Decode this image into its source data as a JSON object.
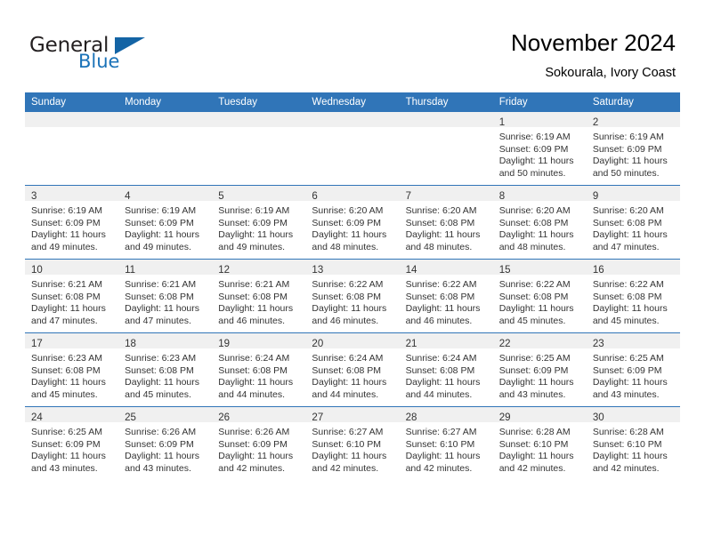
{
  "brand": {
    "name_part1": "General",
    "name_part2": "Blue",
    "flag_icon": "triangle-flag-icon",
    "accent_color": "#1464a5"
  },
  "header": {
    "title": "November 2024",
    "subtitle": "Sokourala, Ivory Coast"
  },
  "calendar": {
    "header_bg": "#3075b8",
    "daynum_bg": "#f0f0f0",
    "weekday_headers": [
      "Sunday",
      "Monday",
      "Tuesday",
      "Wednesday",
      "Thursday",
      "Friday",
      "Saturday"
    ],
    "weeks": [
      [
        {
          "day": "",
          "empty": true,
          "sunrise": "",
          "sunset": "",
          "daylight_line1": "",
          "daylight_line2": ""
        },
        {
          "day": "",
          "empty": true,
          "sunrise": "",
          "sunset": "",
          "daylight_line1": "",
          "daylight_line2": ""
        },
        {
          "day": "",
          "empty": true,
          "sunrise": "",
          "sunset": "",
          "daylight_line1": "",
          "daylight_line2": ""
        },
        {
          "day": "",
          "empty": true,
          "sunrise": "",
          "sunset": "",
          "daylight_line1": "",
          "daylight_line2": ""
        },
        {
          "day": "",
          "empty": true,
          "sunrise": "",
          "sunset": "",
          "daylight_line1": "",
          "daylight_line2": ""
        },
        {
          "day": "1",
          "empty": false,
          "sunrise": "Sunrise: 6:19 AM",
          "sunset": "Sunset: 6:09 PM",
          "daylight_line1": "Daylight: 11 hours",
          "daylight_line2": "and 50 minutes."
        },
        {
          "day": "2",
          "empty": false,
          "sunrise": "Sunrise: 6:19 AM",
          "sunset": "Sunset: 6:09 PM",
          "daylight_line1": "Daylight: 11 hours",
          "daylight_line2": "and 50 minutes."
        }
      ],
      [
        {
          "day": "3",
          "empty": false,
          "sunrise": "Sunrise: 6:19 AM",
          "sunset": "Sunset: 6:09 PM",
          "daylight_line1": "Daylight: 11 hours",
          "daylight_line2": "and 49 minutes."
        },
        {
          "day": "4",
          "empty": false,
          "sunrise": "Sunrise: 6:19 AM",
          "sunset": "Sunset: 6:09 PM",
          "daylight_line1": "Daylight: 11 hours",
          "daylight_line2": "and 49 minutes."
        },
        {
          "day": "5",
          "empty": false,
          "sunrise": "Sunrise: 6:19 AM",
          "sunset": "Sunset: 6:09 PM",
          "daylight_line1": "Daylight: 11 hours",
          "daylight_line2": "and 49 minutes."
        },
        {
          "day": "6",
          "empty": false,
          "sunrise": "Sunrise: 6:20 AM",
          "sunset": "Sunset: 6:09 PM",
          "daylight_line1": "Daylight: 11 hours",
          "daylight_line2": "and 48 minutes."
        },
        {
          "day": "7",
          "empty": false,
          "sunrise": "Sunrise: 6:20 AM",
          "sunset": "Sunset: 6:08 PM",
          "daylight_line1": "Daylight: 11 hours",
          "daylight_line2": "and 48 minutes."
        },
        {
          "day": "8",
          "empty": false,
          "sunrise": "Sunrise: 6:20 AM",
          "sunset": "Sunset: 6:08 PM",
          "daylight_line1": "Daylight: 11 hours",
          "daylight_line2": "and 48 minutes."
        },
        {
          "day": "9",
          "empty": false,
          "sunrise": "Sunrise: 6:20 AM",
          "sunset": "Sunset: 6:08 PM",
          "daylight_line1": "Daylight: 11 hours",
          "daylight_line2": "and 47 minutes."
        }
      ],
      [
        {
          "day": "10",
          "empty": false,
          "sunrise": "Sunrise: 6:21 AM",
          "sunset": "Sunset: 6:08 PM",
          "daylight_line1": "Daylight: 11 hours",
          "daylight_line2": "and 47 minutes."
        },
        {
          "day": "11",
          "empty": false,
          "sunrise": "Sunrise: 6:21 AM",
          "sunset": "Sunset: 6:08 PM",
          "daylight_line1": "Daylight: 11 hours",
          "daylight_line2": "and 47 minutes."
        },
        {
          "day": "12",
          "empty": false,
          "sunrise": "Sunrise: 6:21 AM",
          "sunset": "Sunset: 6:08 PM",
          "daylight_line1": "Daylight: 11 hours",
          "daylight_line2": "and 46 minutes."
        },
        {
          "day": "13",
          "empty": false,
          "sunrise": "Sunrise: 6:22 AM",
          "sunset": "Sunset: 6:08 PM",
          "daylight_line1": "Daylight: 11 hours",
          "daylight_line2": "and 46 minutes."
        },
        {
          "day": "14",
          "empty": false,
          "sunrise": "Sunrise: 6:22 AM",
          "sunset": "Sunset: 6:08 PM",
          "daylight_line1": "Daylight: 11 hours",
          "daylight_line2": "and 46 minutes."
        },
        {
          "day": "15",
          "empty": false,
          "sunrise": "Sunrise: 6:22 AM",
          "sunset": "Sunset: 6:08 PM",
          "daylight_line1": "Daylight: 11 hours",
          "daylight_line2": "and 45 minutes."
        },
        {
          "day": "16",
          "empty": false,
          "sunrise": "Sunrise: 6:22 AM",
          "sunset": "Sunset: 6:08 PM",
          "daylight_line1": "Daylight: 11 hours",
          "daylight_line2": "and 45 minutes."
        }
      ],
      [
        {
          "day": "17",
          "empty": false,
          "sunrise": "Sunrise: 6:23 AM",
          "sunset": "Sunset: 6:08 PM",
          "daylight_line1": "Daylight: 11 hours",
          "daylight_line2": "and 45 minutes."
        },
        {
          "day": "18",
          "empty": false,
          "sunrise": "Sunrise: 6:23 AM",
          "sunset": "Sunset: 6:08 PM",
          "daylight_line1": "Daylight: 11 hours",
          "daylight_line2": "and 45 minutes."
        },
        {
          "day": "19",
          "empty": false,
          "sunrise": "Sunrise: 6:24 AM",
          "sunset": "Sunset: 6:08 PM",
          "daylight_line1": "Daylight: 11 hours",
          "daylight_line2": "and 44 minutes."
        },
        {
          "day": "20",
          "empty": false,
          "sunrise": "Sunrise: 6:24 AM",
          "sunset": "Sunset: 6:08 PM",
          "daylight_line1": "Daylight: 11 hours",
          "daylight_line2": "and 44 minutes."
        },
        {
          "day": "21",
          "empty": false,
          "sunrise": "Sunrise: 6:24 AM",
          "sunset": "Sunset: 6:08 PM",
          "daylight_line1": "Daylight: 11 hours",
          "daylight_line2": "and 44 minutes."
        },
        {
          "day": "22",
          "empty": false,
          "sunrise": "Sunrise: 6:25 AM",
          "sunset": "Sunset: 6:09 PM",
          "daylight_line1": "Daylight: 11 hours",
          "daylight_line2": "and 43 minutes."
        },
        {
          "day": "23",
          "empty": false,
          "sunrise": "Sunrise: 6:25 AM",
          "sunset": "Sunset: 6:09 PM",
          "daylight_line1": "Daylight: 11 hours",
          "daylight_line2": "and 43 minutes."
        }
      ],
      [
        {
          "day": "24",
          "empty": false,
          "sunrise": "Sunrise: 6:25 AM",
          "sunset": "Sunset: 6:09 PM",
          "daylight_line1": "Daylight: 11 hours",
          "daylight_line2": "and 43 minutes."
        },
        {
          "day": "25",
          "empty": false,
          "sunrise": "Sunrise: 6:26 AM",
          "sunset": "Sunset: 6:09 PM",
          "daylight_line1": "Daylight: 11 hours",
          "daylight_line2": "and 43 minutes."
        },
        {
          "day": "26",
          "empty": false,
          "sunrise": "Sunrise: 6:26 AM",
          "sunset": "Sunset: 6:09 PM",
          "daylight_line1": "Daylight: 11 hours",
          "daylight_line2": "and 42 minutes."
        },
        {
          "day": "27",
          "empty": false,
          "sunrise": "Sunrise: 6:27 AM",
          "sunset": "Sunset: 6:10 PM",
          "daylight_line1": "Daylight: 11 hours",
          "daylight_line2": "and 42 minutes."
        },
        {
          "day": "28",
          "empty": false,
          "sunrise": "Sunrise: 6:27 AM",
          "sunset": "Sunset: 6:10 PM",
          "daylight_line1": "Daylight: 11 hours",
          "daylight_line2": "and 42 minutes."
        },
        {
          "day": "29",
          "empty": false,
          "sunrise": "Sunrise: 6:28 AM",
          "sunset": "Sunset: 6:10 PM",
          "daylight_line1": "Daylight: 11 hours",
          "daylight_line2": "and 42 minutes."
        },
        {
          "day": "30",
          "empty": false,
          "sunrise": "Sunrise: 6:28 AM",
          "sunset": "Sunset: 6:10 PM",
          "daylight_line1": "Daylight: 11 hours",
          "daylight_line2": "and 42 minutes."
        }
      ]
    ]
  }
}
